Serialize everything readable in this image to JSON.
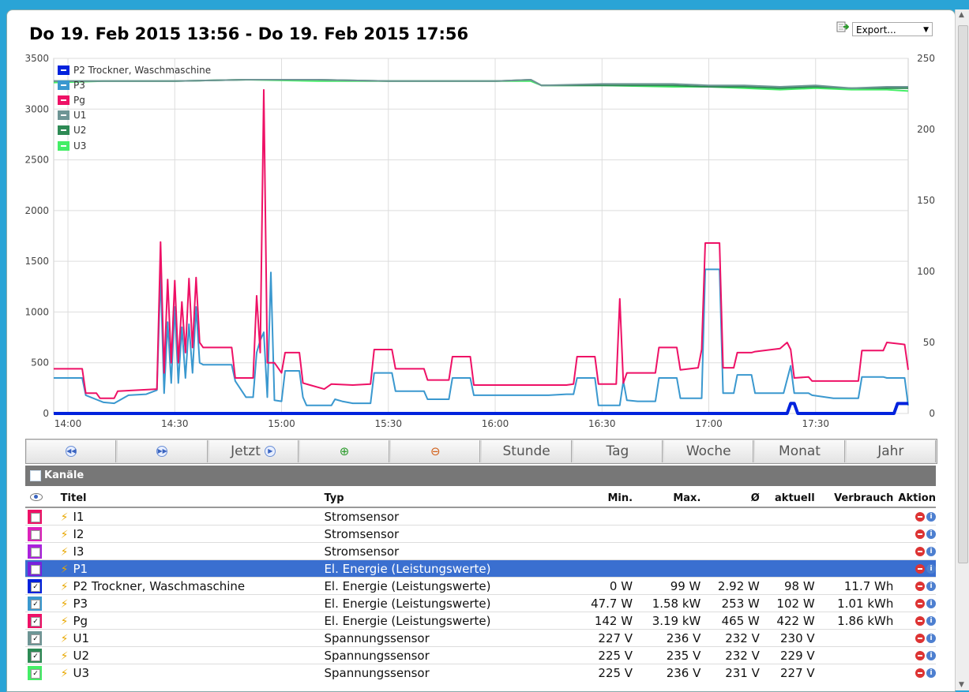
{
  "title": "Do 19. Feb 2015 13:56 - Do 19. Feb 2015 17:56",
  "export": {
    "label": "Export..."
  },
  "legend": [
    {
      "name": "P2 Trockner, Waschmaschine",
      "color": "#0022dd"
    },
    {
      "name": "P3",
      "color": "#3a98cf"
    },
    {
      "name": "Pg",
      "color": "#ee1166"
    },
    {
      "name": "U1",
      "color": "#6e9595"
    },
    {
      "name": "U2",
      "color": "#2e8a55"
    },
    {
      "name": "U3",
      "color": "#44ee66"
    }
  ],
  "chart_data": {
    "type": "line",
    "x_ticks": [
      "14:00",
      "14:30",
      "15:00",
      "15:30",
      "16:00",
      "16:30",
      "17:00",
      "17:30"
    ],
    "y_left_ticks": [
      "0",
      "500",
      "1000",
      "1500",
      "2000",
      "2500",
      "3000",
      "3500"
    ],
    "y_right_ticks": [
      "0",
      "50",
      "100",
      "150",
      "200",
      "250"
    ],
    "ylim_left": [
      0,
      3500
    ],
    "ylim_right": [
      0,
      250
    ],
    "grid": true,
    "legend_position": "top-left",
    "series": [
      {
        "name": "P2 Trockner, Waschmaschine",
        "axis": "left",
        "color": "#0022dd",
        "points": [
          [
            "13:56",
            0
          ],
          [
            "17:22",
            0
          ],
          [
            "17:23",
            99
          ],
          [
            "17:24",
            99
          ],
          [
            "17:25",
            0
          ],
          [
            "17:52",
            0
          ],
          [
            "17:53",
            98
          ],
          [
            "17:56",
            98
          ]
        ]
      },
      {
        "name": "P3",
        "axis": "left",
        "color": "#3a98cf",
        "points": [
          [
            "13:56",
            350
          ],
          [
            "14:04",
            350
          ],
          [
            "14:05",
            180
          ],
          [
            "14:10",
            110
          ],
          [
            "14:13",
            100
          ],
          [
            "14:17",
            180
          ],
          [
            "14:22",
            190
          ],
          [
            "14:25",
            230
          ],
          [
            "14:26",
            1380
          ],
          [
            "14:27",
            200
          ],
          [
            "14:28",
            900
          ],
          [
            "14:29",
            300
          ],
          [
            "14:30",
            1050
          ],
          [
            "14:31",
            300
          ],
          [
            "14:32",
            850
          ],
          [
            "14:33",
            350
          ],
          [
            "14:34",
            880
          ],
          [
            "14:35",
            400
          ],
          [
            "14:36",
            1050
          ],
          [
            "14:37",
            500
          ],
          [
            "14:38",
            480
          ],
          [
            "14:46",
            480
          ],
          [
            "14:47",
            320
          ],
          [
            "14:50",
            160
          ],
          [
            "14:52",
            160
          ],
          [
            "14:53",
            600
          ],
          [
            "14:54",
            720
          ],
          [
            "14:55",
            800
          ],
          [
            "14:56",
            160
          ],
          [
            "14:57",
            1390
          ],
          [
            "14:58",
            130
          ],
          [
            "15:00",
            120
          ],
          [
            "15:01",
            420
          ],
          [
            "15:05",
            420
          ],
          [
            "15:06",
            160
          ],
          [
            "15:07",
            80
          ],
          [
            "15:14",
            80
          ],
          [
            "15:15",
            140
          ],
          [
            "15:17",
            120
          ],
          [
            "15:20",
            100
          ],
          [
            "15:25",
            100
          ],
          [
            "15:26",
            400
          ],
          [
            "15:31",
            400
          ],
          [
            "15:32",
            220
          ],
          [
            "15:40",
            220
          ],
          [
            "15:41",
            140
          ],
          [
            "15:47",
            140
          ],
          [
            "15:48",
            350
          ],
          [
            "15:53",
            350
          ],
          [
            "15:54",
            180
          ],
          [
            "16:00",
            180
          ],
          [
            "16:05",
            180
          ],
          [
            "16:10",
            180
          ],
          [
            "16:15",
            180
          ],
          [
            "16:20",
            190
          ],
          [
            "16:22",
            190
          ],
          [
            "16:23",
            350
          ],
          [
            "16:28",
            350
          ],
          [
            "16:29",
            80
          ],
          [
            "16:34",
            80
          ],
          [
            "16:35",
            80
          ],
          [
            "16:36",
            320
          ],
          [
            "16:37",
            130
          ],
          [
            "16:40",
            120
          ],
          [
            "16:45",
            120
          ],
          [
            "16:46",
            350
          ],
          [
            "16:51",
            350
          ],
          [
            "16:52",
            150
          ],
          [
            "16:58",
            150
          ],
          [
            "16:59",
            1420
          ],
          [
            "17:03",
            1420
          ],
          [
            "17:04",
            200
          ],
          [
            "17:07",
            200
          ],
          [
            "17:08",
            380
          ],
          [
            "17:12",
            380
          ],
          [
            "17:13",
            200
          ],
          [
            "17:20",
            200
          ],
          [
            "17:21",
            200
          ],
          [
            "17:23",
            470
          ],
          [
            "17:24",
            200
          ],
          [
            "17:28",
            200
          ],
          [
            "17:29",
            180
          ],
          [
            "17:35",
            150
          ],
          [
            "17:42",
            150
          ],
          [
            "17:43",
            360
          ],
          [
            "17:49",
            360
          ],
          [
            "17:50",
            350
          ],
          [
            "17:55",
            350
          ],
          [
            "17:56",
            80
          ]
        ]
      },
      {
        "name": "Pg",
        "axis": "left",
        "color": "#ee1166",
        "points": [
          [
            "13:56",
            440
          ],
          [
            "14:04",
            440
          ],
          [
            "14:05",
            200
          ],
          [
            "14:08",
            200
          ],
          [
            "14:09",
            150
          ],
          [
            "14:13",
            150
          ],
          [
            "14:14",
            220
          ],
          [
            "14:25",
            240
          ],
          [
            "14:26",
            1690
          ],
          [
            "14:27",
            400
          ],
          [
            "14:28",
            1320
          ],
          [
            "14:29",
            500
          ],
          [
            "14:30",
            1310
          ],
          [
            "14:31",
            500
          ],
          [
            "14:32",
            1100
          ],
          [
            "14:33",
            600
          ],
          [
            "14:34",
            1330
          ],
          [
            "14:35",
            650
          ],
          [
            "14:36",
            1340
          ],
          [
            "14:37",
            700
          ],
          [
            "14:38",
            650
          ],
          [
            "14:46",
            650
          ],
          [
            "14:47",
            350
          ],
          [
            "14:51",
            350
          ],
          [
            "14:52",
            350
          ],
          [
            "14:53",
            1160
          ],
          [
            "14:54",
            600
          ],
          [
            "14:55",
            3190
          ],
          [
            "14:56",
            500
          ],
          [
            "14:57",
            500
          ],
          [
            "14:58",
            500
          ],
          [
            "15:00",
            400
          ],
          [
            "15:01",
            600
          ],
          [
            "15:05",
            600
          ],
          [
            "15:06",
            300
          ],
          [
            "15:08",
            280
          ],
          [
            "15:12",
            240
          ],
          [
            "15:14",
            290
          ],
          [
            "15:20",
            280
          ],
          [
            "15:25",
            290
          ],
          [
            "15:26",
            630
          ],
          [
            "15:31",
            630
          ],
          [
            "15:32",
            440
          ],
          [
            "15:40",
            440
          ],
          [
            "15:41",
            330
          ],
          [
            "15:47",
            330
          ],
          [
            "15:48",
            560
          ],
          [
            "15:53",
            560
          ],
          [
            "15:54",
            280
          ],
          [
            "16:00",
            280
          ],
          [
            "16:10",
            280
          ],
          [
            "16:20",
            280
          ],
          [
            "16:22",
            290
          ],
          [
            "16:23",
            560
          ],
          [
            "16:28",
            560
          ],
          [
            "16:29",
            290
          ],
          [
            "16:34",
            290
          ],
          [
            "16:35",
            1130
          ],
          [
            "16:36",
            300
          ],
          [
            "16:37",
            400
          ],
          [
            "16:40",
            400
          ],
          [
            "16:45",
            400
          ],
          [
            "16:46",
            650
          ],
          [
            "16:51",
            650
          ],
          [
            "16:52",
            430
          ],
          [
            "16:57",
            450
          ],
          [
            "16:58",
            630
          ],
          [
            "16:59",
            1680
          ],
          [
            "17:03",
            1680
          ],
          [
            "17:04",
            450
          ],
          [
            "17:07",
            450
          ],
          [
            "17:08",
            600
          ],
          [
            "17:12",
            600
          ],
          [
            "17:13",
            610
          ],
          [
            "17:20",
            640
          ],
          [
            "17:22",
            700
          ],
          [
            "17:23",
            630
          ],
          [
            "17:24",
            350
          ],
          [
            "17:28",
            360
          ],
          [
            "17:29",
            320
          ],
          [
            "17:35",
            320
          ],
          [
            "17:42",
            320
          ],
          [
            "17:43",
            620
          ],
          [
            "17:49",
            620
          ],
          [
            "17:50",
            700
          ],
          [
            "17:55",
            680
          ],
          [
            "17:56",
            430
          ]
        ]
      },
      {
        "name": "U1",
        "axis": "right",
        "color": "#6e9595",
        "points": [
          [
            "13:56",
            234
          ],
          [
            "14:10",
            234
          ],
          [
            "14:30",
            234
          ],
          [
            "14:50",
            235
          ],
          [
            "15:10",
            235
          ],
          [
            "15:30",
            234
          ],
          [
            "15:50",
            234
          ],
          [
            "16:00",
            234
          ],
          [
            "16:10",
            235
          ],
          [
            "16:13",
            231
          ],
          [
            "16:30",
            232
          ],
          [
            "16:50",
            232
          ],
          [
            "17:00",
            231
          ],
          [
            "17:10",
            231
          ],
          [
            "17:20",
            230
          ],
          [
            "17:30",
            231
          ],
          [
            "17:40",
            229
          ],
          [
            "17:50",
            230
          ],
          [
            "17:56",
            230
          ]
        ]
      },
      {
        "name": "U2",
        "axis": "right",
        "color": "#2e8a55",
        "points": [
          [
            "13:56",
            234
          ],
          [
            "14:10",
            234
          ],
          [
            "14:30",
            234
          ],
          [
            "14:50",
            235
          ],
          [
            "15:10",
            235
          ],
          [
            "15:30",
            234
          ],
          [
            "15:50",
            234
          ],
          [
            "16:00",
            234
          ],
          [
            "16:10",
            235
          ],
          [
            "16:13",
            231
          ],
          [
            "16:30",
            231
          ],
          [
            "16:50",
            231
          ],
          [
            "17:00",
            230
          ],
          [
            "17:10",
            230
          ],
          [
            "17:20",
            229
          ],
          [
            "17:30",
            230
          ],
          [
            "17:40",
            229
          ],
          [
            "17:50",
            229
          ],
          [
            "17:56",
            229
          ]
        ]
      },
      {
        "name": "U3",
        "axis": "right",
        "color": "#44ee66",
        "points": [
          [
            "13:56",
            233
          ],
          [
            "14:10",
            234
          ],
          [
            "14:30",
            234
          ],
          [
            "14:50",
            235
          ],
          [
            "15:10",
            234
          ],
          [
            "15:30",
            234
          ],
          [
            "15:50",
            234
          ],
          [
            "16:00",
            234
          ],
          [
            "16:10",
            234
          ],
          [
            "16:13",
            231
          ],
          [
            "16:30",
            231
          ],
          [
            "16:50",
            230
          ],
          [
            "17:00",
            230
          ],
          [
            "17:10",
            229
          ],
          [
            "17:20",
            228
          ],
          [
            "17:30",
            229
          ],
          [
            "17:40",
            228
          ],
          [
            "17:50",
            228
          ],
          [
            "17:56",
            227
          ]
        ]
      }
    ]
  },
  "nav": {
    "buttons": [
      "",
      "",
      "Jetzt",
      "",
      "",
      "Stunde",
      "Tag",
      "Woche",
      "Monat",
      "Jahr"
    ]
  },
  "channels": {
    "section_title": "Kanäle",
    "headers": {
      "titel": "Titel",
      "typ": "Typ",
      "min": "Min.",
      "max": "Max.",
      "avg": "Ø",
      "aktuell": "aktuell",
      "verbrauch": "Verbrauch",
      "aktion": "Aktion"
    },
    "rows": [
      {
        "color": "#ee1166",
        "checked": false,
        "titel": "I1",
        "typ": "Stromsensor",
        "min": "",
        "max": "",
        "avg": "",
        "aktuell": "",
        "verbrauch": ""
      },
      {
        "color": "#dd22bb",
        "checked": false,
        "titel": "I2",
        "typ": "Stromsensor",
        "min": "",
        "max": "",
        "avg": "",
        "aktuell": "",
        "verbrauch": ""
      },
      {
        "color": "#aa22dd",
        "checked": false,
        "titel": "I3",
        "typ": "Stromsensor",
        "min": "",
        "max": "",
        "avg": "",
        "aktuell": "",
        "verbrauch": ""
      },
      {
        "color": "#7722dd",
        "checked": false,
        "titel": "P1",
        "typ": "El. Energie (Leistungswerte)",
        "min": "",
        "max": "",
        "avg": "",
        "aktuell": "",
        "verbrauch": "",
        "selected": true
      },
      {
        "color": "#0022dd",
        "checked": true,
        "titel": "P2 Trockner, Waschmaschine",
        "typ": "El. Energie (Leistungswerte)",
        "min": "0 W",
        "max": "99 W",
        "avg": "2.92 W",
        "aktuell": "98 W",
        "verbrauch": "11.7 Wh"
      },
      {
        "color": "#3a98cf",
        "checked": true,
        "titel": "P3",
        "typ": "El. Energie (Leistungswerte)",
        "min": "47.7 W",
        "max": "1.58 kW",
        "avg": "253 W",
        "aktuell": "102 W",
        "verbrauch": "1.01 kWh"
      },
      {
        "color": "#ee1166",
        "checked": true,
        "titel": "Pg",
        "typ": "El. Energie (Leistungswerte)",
        "min": "142 W",
        "max": "3.19 kW",
        "avg": "465 W",
        "aktuell": "422 W",
        "verbrauch": "1.86 kWh"
      },
      {
        "color": "#6e9595",
        "checked": true,
        "titel": "U1",
        "typ": "Spannungssensor",
        "min": "227 V",
        "max": "236 V",
        "avg": "232 V",
        "aktuell": "230 V",
        "verbrauch": ""
      },
      {
        "color": "#2e8a55",
        "checked": true,
        "titel": "U2",
        "typ": "Spannungssensor",
        "min": "225 V",
        "max": "235 V",
        "avg": "232 V",
        "aktuell": "229 V",
        "verbrauch": ""
      },
      {
        "color": "#44ee66",
        "checked": true,
        "titel": "U3",
        "typ": "Spannungssensor",
        "min": "225 V",
        "max": "236 V",
        "avg": "231 V",
        "aktuell": "227 V",
        "verbrauch": ""
      }
    ]
  }
}
